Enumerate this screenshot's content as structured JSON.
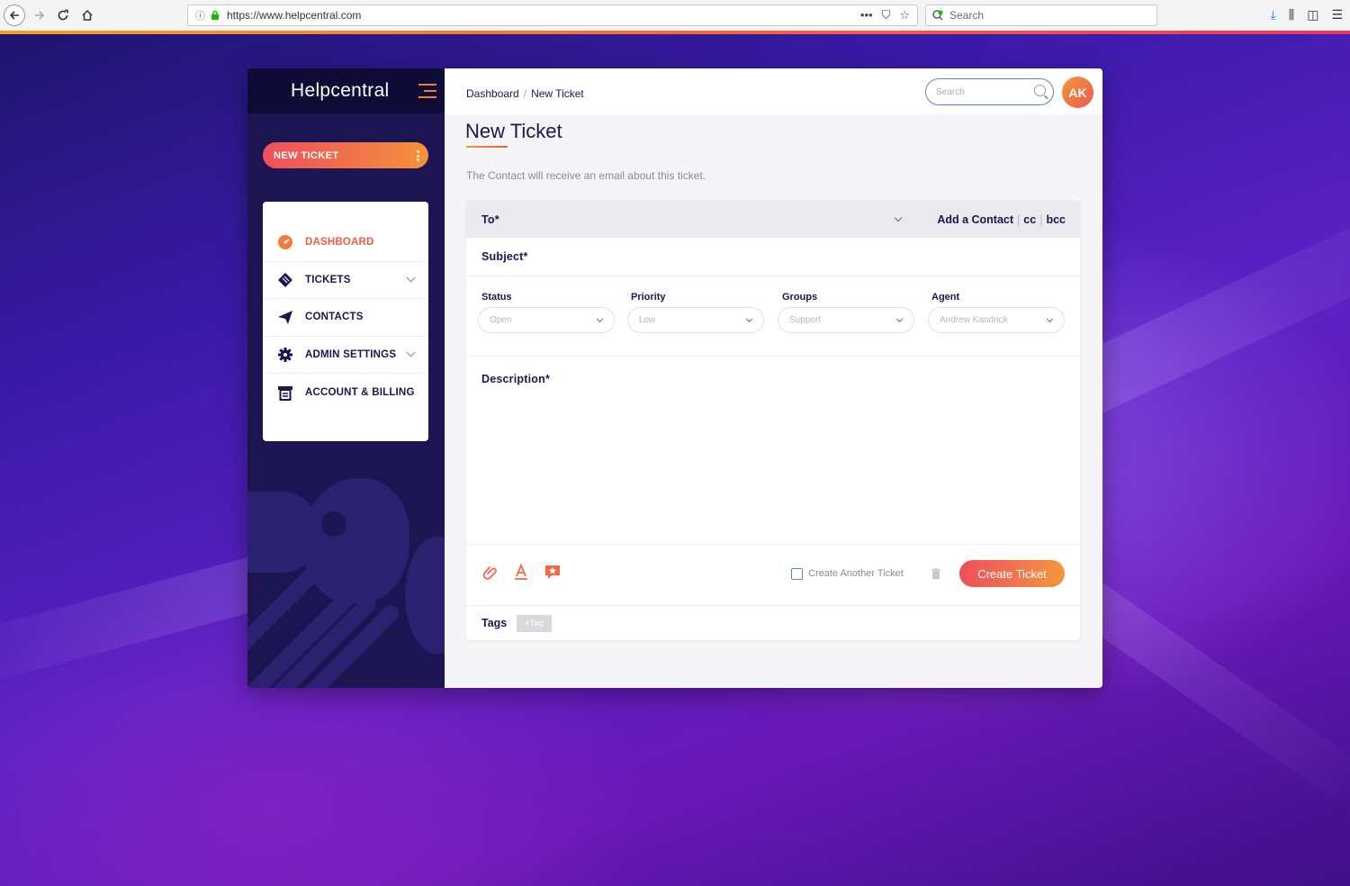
{
  "browser": {
    "url": "https://www.helpcentral.com",
    "search_placeholder": "Search"
  },
  "sidebar": {
    "brand": "Helpcentral",
    "new_ticket_label": "NEW TICKET",
    "items": [
      {
        "label": "DASHBOARD",
        "icon": "dashboard-icon",
        "active": true
      },
      {
        "label": "TICKETS",
        "icon": "ticket-icon",
        "expandable": true
      },
      {
        "label": "CONTACTS",
        "icon": "paper-plane-icon"
      },
      {
        "label": "ADMIN SETTINGS",
        "icon": "gear-icon",
        "expandable": true
      },
      {
        "label": "ACCOUNT & BILLING",
        "icon": "billing-icon"
      }
    ]
  },
  "header": {
    "breadcrumb": [
      "Dashboard",
      "New Ticket"
    ],
    "search_placeholder": "Search",
    "avatar_initials": "AK"
  },
  "page": {
    "title": "New Ticket",
    "subtitle": "The Contact will receive an email about this ticket."
  },
  "form": {
    "to_label": "To*",
    "add_contact": "Add a Contact",
    "cc": "cc",
    "bcc": "bcc",
    "subject_label": "Subject*",
    "selects": [
      {
        "label": "Status",
        "value": "Open"
      },
      {
        "label": "Priority",
        "value": "Low"
      },
      {
        "label": "Groups",
        "value": "Support"
      },
      {
        "label": "Agent",
        "value": "Andrew Kandrick"
      }
    ],
    "description_label": "Description*",
    "create_another_label": "Create Another Ticket",
    "create_button": "Create Ticket",
    "tags_label": "Tags",
    "add_tag": "+Tag"
  },
  "colors": {
    "accent_start": "#ec4f5e",
    "accent_end": "#f5963c",
    "sidebar_bg": "#1c1552",
    "text_dark": "#1c1552"
  }
}
